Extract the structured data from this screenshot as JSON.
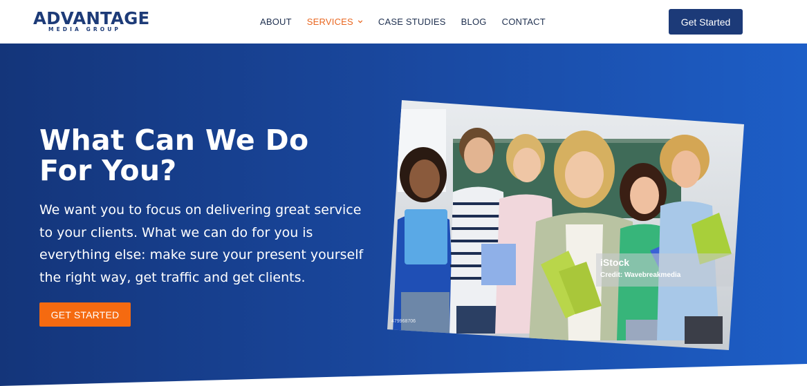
{
  "logo": {
    "main": "ADVANTAGE",
    "sub": "MEDIA GROUP"
  },
  "nav": {
    "items": [
      {
        "label": "ABOUT"
      },
      {
        "label": "SERVICES"
      },
      {
        "label": "CASE STUDIES"
      },
      {
        "label": "BLOG"
      },
      {
        "label": "CONTACT"
      }
    ],
    "active_index": 1,
    "cta_label": "Get Started"
  },
  "hero": {
    "headline": "What Can We Do For You?",
    "subtext": "We want you to focus on delivering great service to your clients. What we can do for you is everything else: make sure your present yourself the right way, get traffic and get clients.",
    "cta_label": "GET STARTED"
  },
  "photo": {
    "watermark_brand": "iStock",
    "watermark_credit": "Credit: Wavebreakmedia",
    "stock_id": "479968706"
  },
  "colors": {
    "brand_navy": "#1c3a78",
    "accent_orange": "#f56a10",
    "hero_start": "#14357a",
    "hero_end": "#1d5ec7"
  }
}
